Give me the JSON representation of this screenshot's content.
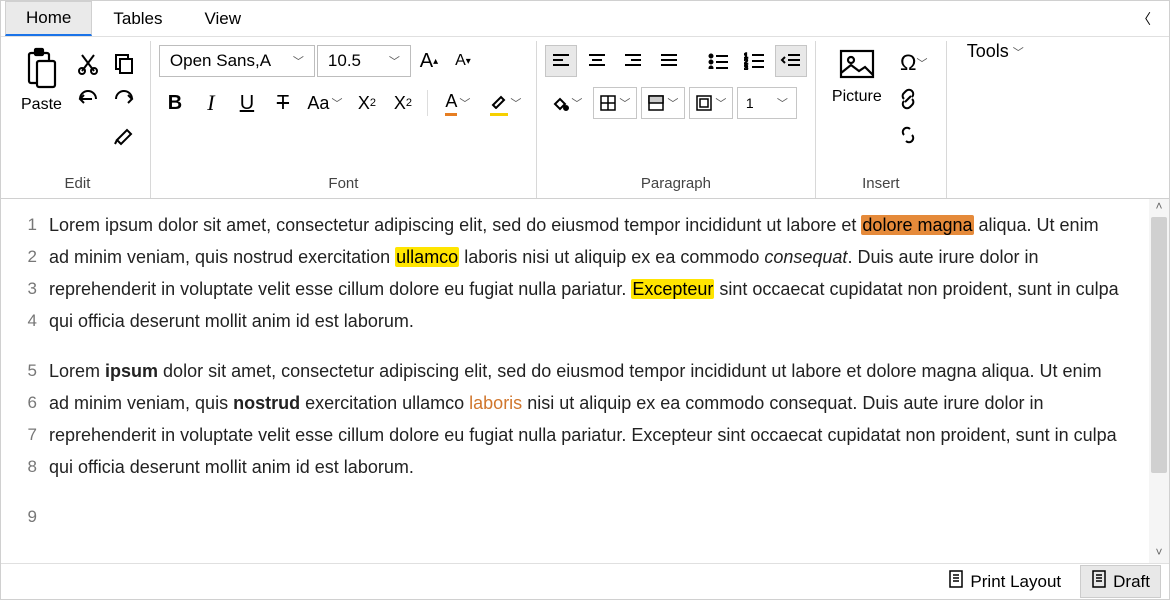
{
  "tabs": {
    "home": "Home",
    "tables": "Tables",
    "view": "View"
  },
  "edit": {
    "group": "Edit",
    "paste": "Paste"
  },
  "font": {
    "group": "Font",
    "name": "Open Sans,A",
    "size": "10.5"
  },
  "paragraph": {
    "group": "Paragraph",
    "spacing": "1"
  },
  "insert": {
    "group": "Insert",
    "picture": "Picture"
  },
  "tools": {
    "label": "Tools"
  },
  "status": {
    "print_layout": "Print Layout",
    "draft": "Draft"
  },
  "line_numbers": [
    "1",
    "2",
    "3",
    "4",
    "5",
    "6",
    "7",
    "8",
    "9"
  ],
  "para1": {
    "t0": "Lorem ipsum dolor sit amet, consectetur adipiscing elit, sed do eiusmod tempor incididunt ut labore et ",
    "h1": "dolore magna",
    "t1": " aliqua. Ut enim ad minim veniam, quis nostrud exercitation ",
    "h2": "ullamco",
    "t2": " laboris nisi ut aliquip ex ea commodo ",
    "i1": "consequat",
    "t3": ". Duis aute irure dolor in reprehenderit in voluptate velit esse cillum dolore eu fugiat nulla pariatur. ",
    "h3": "Excepteur",
    "t4": " sint occaecat cupidatat non proident, sunt in culpa qui officia deserunt mollit anim id est laborum."
  },
  "para2": {
    "t0": "Lorem ",
    "b1": "ipsum",
    "t1": " dolor sit amet, consectetur adipiscing elit, sed do eiusmod tempor incididunt ut labore et dolore magna aliqua. Ut enim ad minim veniam, quis ",
    "b2": "nostrud",
    "t2": " exercitation ullamco ",
    "o1": "laboris",
    "t3": " nisi ut aliquip ex ea commodo consequat. Duis aute irure dolor in reprehenderit in voluptate velit esse cillum dolore eu fugiat nulla pariatur. Excepteur sint occaecat cupidatat non proident, sunt in culpa qui officia deserunt mollit anim id est laborum."
  }
}
